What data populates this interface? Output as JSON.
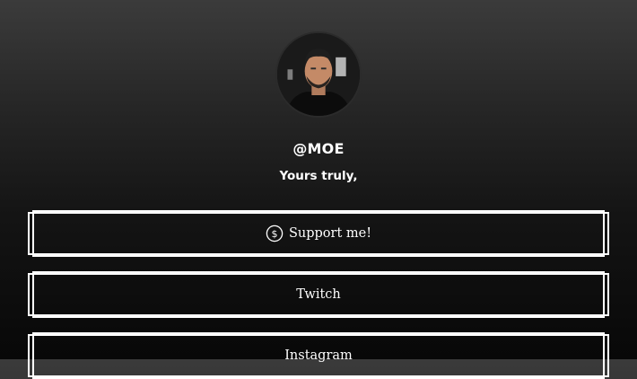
{
  "profile": {
    "username": "@MOE",
    "tagline": "Yours truly,"
  },
  "links": [
    {
      "label": "Support me!",
      "icon": "dollar-circle-icon"
    },
    {
      "label": "Twitch"
    },
    {
      "label": "Instagram"
    }
  ],
  "colors": {
    "background_top": "#3b3b3b",
    "background_bottom": "#080808",
    "text": "#ffffff",
    "button_border": "#ffffff"
  }
}
